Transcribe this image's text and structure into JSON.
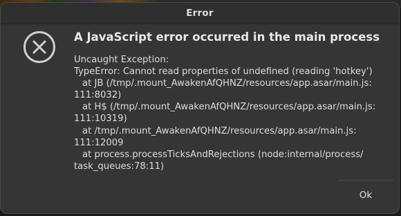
{
  "dialog": {
    "title": "Error",
    "icon": "error-circle-x-icon",
    "heading": "A JavaScript error occurred in the main process",
    "message_lines": [
      "Uncaught Exception:",
      "TypeError: Cannot read properties of undefined (reading 'hotkey')",
      "    at JB (/tmp/.mount_AwakenAfQHNZ/resources/app.asar/main.js:",
      "111:8032)",
      "    at H$ (/tmp/.mount_AwakenAfQHNZ/resources/app.asar/main.js:",
      "111:10319)",
      "    at /tmp/.mount_AwakenAfQHNZ/resources/app.asar/main.js:",
      "111:12009",
      "    at process.processTicksAndRejections (node:internal/process/",
      "task_queues:78:11)"
    ],
    "ok_label": "Ok"
  }
}
